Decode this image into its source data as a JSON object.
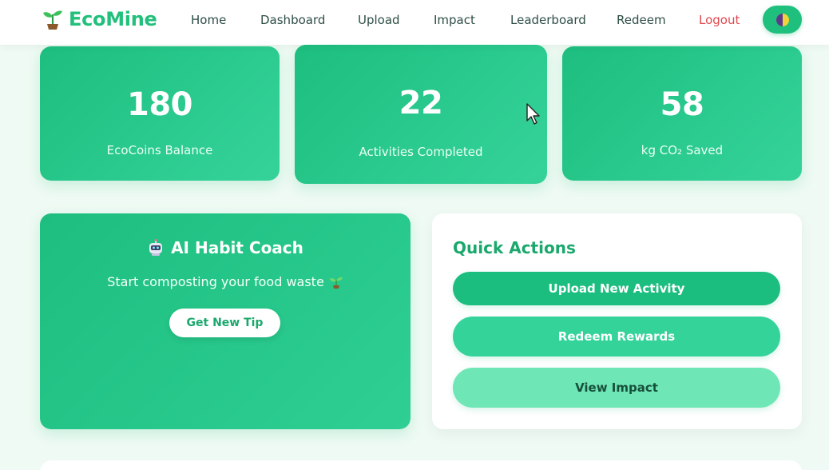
{
  "navbar": {
    "brand": "EcoMine",
    "links": [
      "Home",
      "Dashboard",
      "Upload",
      "Impact",
      "Leaderboard",
      "Redeem"
    ],
    "logout": "Logout",
    "brand_icon": "sprout-icon",
    "toggle_icon": "theme-toggle-icon"
  },
  "stats": [
    {
      "value": "180",
      "label": "EcoCoins Balance"
    },
    {
      "value": "22",
      "label": "Activities Completed"
    },
    {
      "value": "58",
      "label": "kg CO₂ Saved"
    }
  ],
  "coach": {
    "title": "AI Habit Coach",
    "tip": "Start composting your food waste",
    "button": "Get New Tip",
    "title_icon": "robot-icon",
    "tip_icon": "sprout-icon"
  },
  "quick_actions": {
    "title": "Quick Actions",
    "upload": "Upload New Activity",
    "redeem": "Redeem Rewards",
    "impact": "View Impact"
  },
  "colors": {
    "primary": "#1fbf7d",
    "logout": "#e0484f",
    "background": "#eefaf3"
  }
}
